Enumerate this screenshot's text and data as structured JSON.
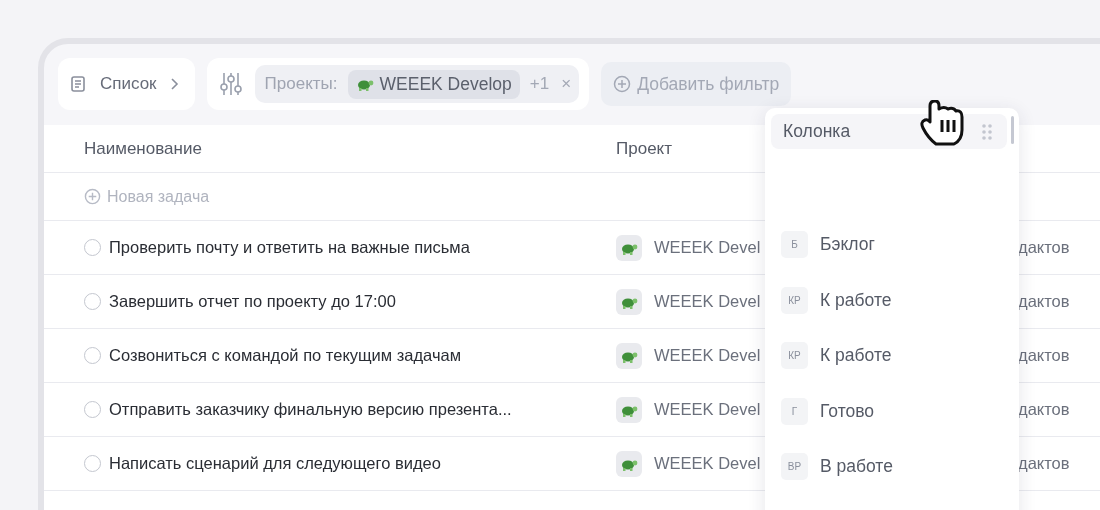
{
  "toolbar": {
    "view": {
      "label": "Список"
    },
    "filter": {
      "label": "Проекты:",
      "project": "WEEEK Develop",
      "more": "+1",
      "clear": "×"
    },
    "add_filter": {
      "label": "Добавить фильтр"
    }
  },
  "table": {
    "columns": [
      "Наименование",
      "Проект"
    ],
    "new_task": "Новая задача",
    "rows": [
      {
        "name": "Проверить почту и ответить на важные письма",
        "project": "WEEEK Devel",
        "column_3": "дактов",
        "done": false
      },
      {
        "name": "Завершить отчет по проекту до 17:00",
        "project": "WEEEK Devel",
        "column_3": "дактов",
        "done": false
      },
      {
        "name": "Созвониться с командой по текущим задачам",
        "project": "WEEEK Devel",
        "column_3": "дактов",
        "done": false
      },
      {
        "name": "Отправить заказчику финальную версию презента...",
        "project": "WEEEK Devel",
        "column_3": "дактов",
        "done": false
      },
      {
        "name": "Написать сценарий для следующего видео",
        "project": "WEEEK Devel",
        "column_3": "дактов",
        "done": false
      }
    ]
  },
  "dropdown": {
    "header": "Колонка",
    "items": [
      {
        "badge": "Б",
        "label": "Бэклог"
      },
      {
        "badge": "КР",
        "label": "К работе"
      },
      {
        "badge": "КР",
        "label": "К работе"
      },
      {
        "badge": "Г",
        "label": "Готово"
      },
      {
        "badge": "ВР",
        "label": "В работе"
      }
    ]
  }
}
